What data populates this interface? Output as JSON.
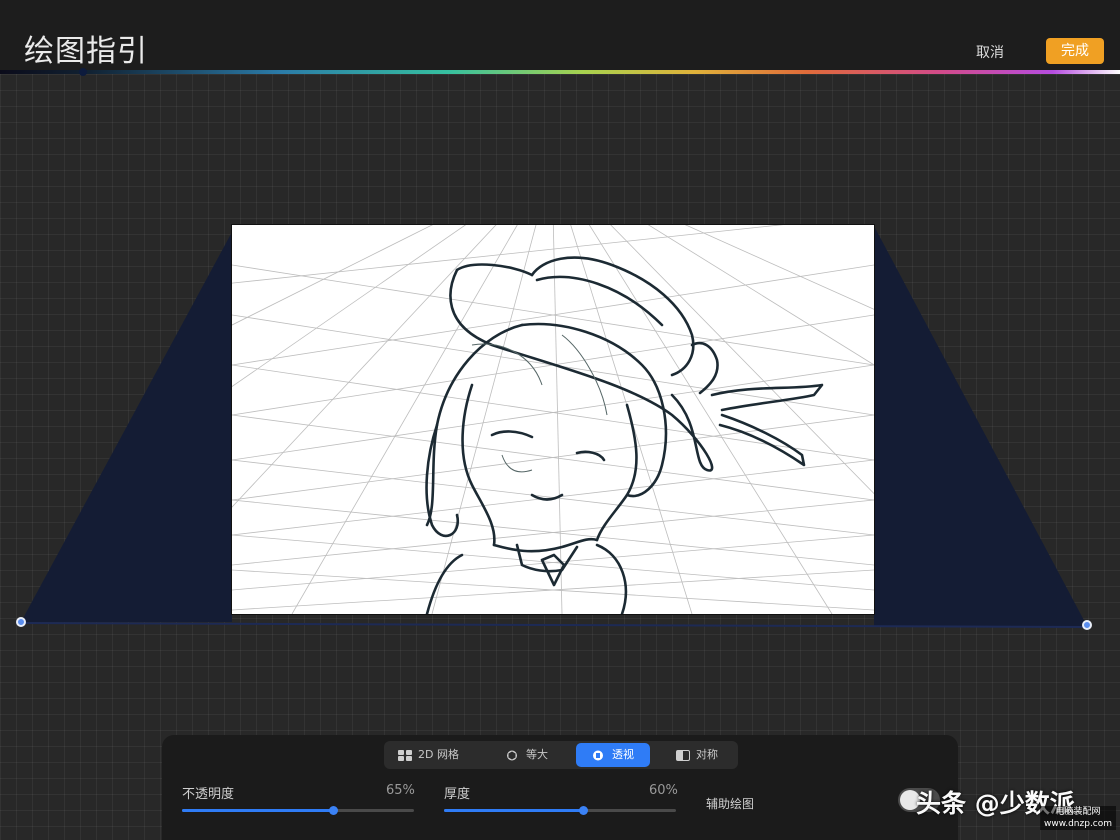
{
  "header": {
    "title": "绘图指引",
    "cancel_label": "取消",
    "done_label": "完成"
  },
  "colors": {
    "accent": "#2f7cf6",
    "done_button": "#f0a023",
    "perspective_plane": "#141c34"
  },
  "guide_modes": {
    "tabs": [
      {
        "label": "2D 网格",
        "icon": "grid-icon",
        "active": false
      },
      {
        "label": "等大",
        "icon": "cube-icon",
        "active": false
      },
      {
        "label": "透视",
        "icon": "perspective-icon",
        "active": true
      },
      {
        "label": "对称",
        "icon": "symmetry-icon",
        "active": false
      }
    ]
  },
  "opacity": {
    "label": "不透明度",
    "value": 65,
    "value_text": "65%"
  },
  "thickness": {
    "label": "厚度",
    "value": 60,
    "value_text": "60%"
  },
  "assisted_drawing": {
    "label": "辅助绘图",
    "enabled": false
  },
  "watermark": {
    "text": "头条 @少数派",
    "sub": "电脑装配网 www.dnzp.com"
  }
}
